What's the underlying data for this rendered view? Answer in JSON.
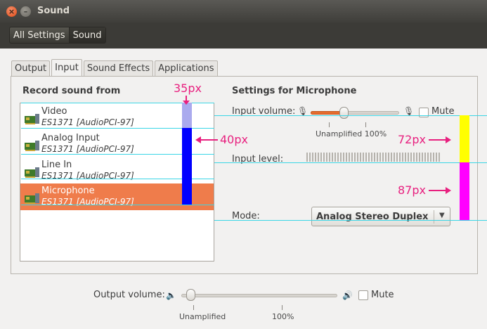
{
  "window": {
    "title": "Sound",
    "close_glyph": "×",
    "min_glyph": "–"
  },
  "breadcrumb": {
    "items": [
      "All Settings",
      "Sound"
    ]
  },
  "tabs": [
    "Output",
    "Input",
    "Sound Effects",
    "Applications"
  ],
  "record_from": {
    "heading": "Record sound from",
    "devices": [
      {
        "name": "Video",
        "sub": "ES1371 [AudioPCI-97]"
      },
      {
        "name": "Analog Input",
        "sub": "ES1371 [AudioPCI-97]"
      },
      {
        "name": "Line In",
        "sub": "ES1371 [AudioPCI-97]"
      },
      {
        "name": "Microphone",
        "sub": "ES1371 [AudioPCI-97]",
        "selected": true
      }
    ]
  },
  "settings": {
    "heading": "Settings for Microphone",
    "input_volume_label": "Input volume:",
    "input_volume_percent": 37,
    "mute_label": "Mute",
    "ticks": {
      "unamplified": "Unamplified 100%"
    },
    "input_level_label": "Input level:",
    "mode_label": "Mode:",
    "mode_value": "Analog Stereo Duplex"
  },
  "output": {
    "label": "Output volume:",
    "volume_percent": 4,
    "mute_label": "Mute",
    "tick_unamplified": "Unamplified",
    "tick_100": "100%"
  },
  "annotations": {
    "a35": "35px",
    "a40": "40px",
    "a72": "72px",
    "a87": "87px",
    "colors": {
      "guide": "#3ad6e6",
      "magenta": "#ff00ff",
      "yellow": "#ffff00",
      "blue": "#0000ff",
      "light_blue": "#aaaaee",
      "pink_text": "#e8207f"
    }
  },
  "icons": {
    "device": "sound-card-icon",
    "mic_low": "microphone-low-icon",
    "mic_high": "microphone-high-icon",
    "speaker_low": "speaker-low-icon",
    "speaker_high": "speaker-high-icon"
  },
  "colors": {
    "accent": "#ef7c4b",
    "slider_fill": "#e56c2e"
  }
}
